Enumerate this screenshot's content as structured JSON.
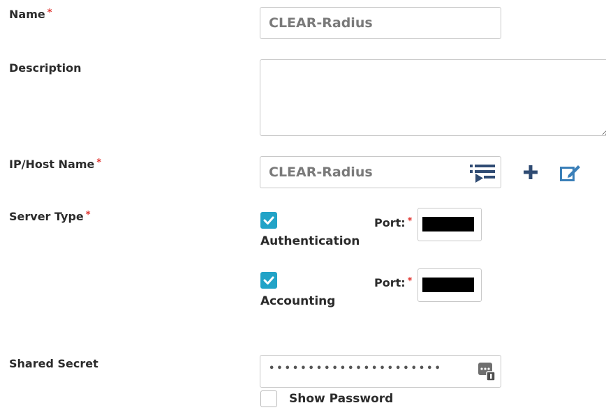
{
  "form": {
    "name": {
      "label": "Name",
      "required_mark": "*",
      "value": "CLEAR-Radius"
    },
    "description": {
      "label": "Description",
      "value": ""
    },
    "ip_host": {
      "label": "IP/Host Name",
      "required_mark": "*",
      "value": "CLEAR-Radius"
    },
    "server_type": {
      "label": "Server Type",
      "required_mark": "*",
      "authentication": {
        "label": "Authentication",
        "checked": true,
        "port_label": "Port:",
        "port_required_mark": "*"
      },
      "accounting": {
        "label": "Accounting",
        "checked": true,
        "port_label": "Port:",
        "port_required_mark": "*"
      }
    },
    "shared_secret": {
      "label": "Shared Secret",
      "masked_value": "••••••••••••••••••••••",
      "show_password_label": "Show Password",
      "show_password_checked": false
    }
  },
  "icons": {
    "host_list": "list-select-icon",
    "add": "plus-icon",
    "edit": "edit-icon",
    "secret": "password-manager-icon"
  },
  "colors": {
    "accent": "#22a3c7",
    "required": "#e0342f",
    "icon": "#2f4b73"
  }
}
